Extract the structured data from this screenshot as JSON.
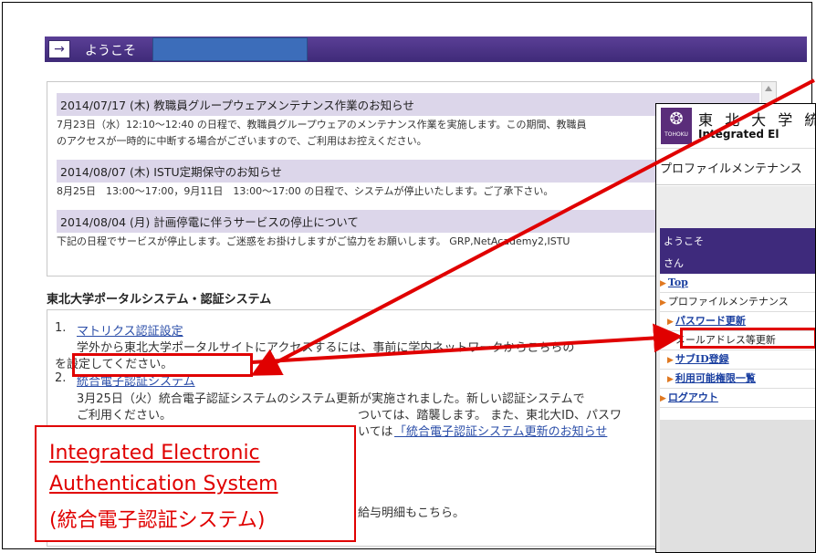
{
  "header": {
    "welcome_label": "ようこそ",
    "arrow_icon": "right-arrow-icon"
  },
  "news": [
    {
      "title": "2014/07/17 (木) 教職員グループウェアメンテナンス作業のお知らせ",
      "body_lines": [
        "7月23日（水）12:10～12:40 の日程で、教職員グループウェアのメンテナンス作業を実施します。この期間、教職員",
        "のアクセスが一時的に中断する場合がございますので、ご利用はお控えください。"
      ]
    },
    {
      "title": "2014/08/07 (木) ISTU定期保守のお知らせ",
      "body_lines": [
        "8月25日　13:00～17:00，9月11日　13:00～17:00 の日程で、システムが停止いたします。ご了承下さい。"
      ]
    },
    {
      "title": "2014/08/04 (月) 計画停電に伴うサービスの停止について",
      "body_lines": [
        "下記の日程でサービスが停止します。ご迷惑をお掛けしますがご協力をお願いします。 GRP,NetAcademy2,ISTU"
      ]
    }
  ],
  "portal": {
    "section_title": "東北大学ポータルシステム・認証システム",
    "items": [
      {
        "num": "1.",
        "link": "マトリクス認証設定",
        "desc_lines": [
          "学外から東北大学ポータルサイトにアクセスするには、事前に学内ネットワークからこちらの",
          "を設定してください。"
        ]
      },
      {
        "num": "2.",
        "link": "統合電子認証システム",
        "desc_lines": [
          "3月25日（火）統合電子認証システムのシステム更新が実施されました。新しい認証システムで",
          "ご利用ください。",
          "ついては、踏襲します。 また、東北大ID、パスワ",
          "いては",
          "「統合電子認証システム更新のお知らせ"
        ]
      }
    ],
    "bottom_line": "給与明細もこちら。"
  },
  "callout": {
    "line1": "Integrated Electronic",
    "line2": "Authentication System",
    "line3": "(統合電子認証システム)"
  },
  "side": {
    "logo_text": "TOHOKU",
    "university_jp": "東 北 大 学 統",
    "university_en": "Integrated El",
    "page_title": "プロファイルメンテナンス",
    "welcome": "ようこそ",
    "san": "さん",
    "menu": [
      {
        "label": "Top",
        "link": true,
        "indent": false
      },
      {
        "label": "プロファイルメンテナンス",
        "link": false,
        "indent": false
      },
      {
        "label": "パスワード更新",
        "link": true,
        "indent": true
      },
      {
        "label": "メールアドレス等更新",
        "link": false,
        "indent": true
      },
      {
        "label": "サブID登録",
        "link": true,
        "indent": true
      },
      {
        "label": "利用可能権限一覧",
        "link": true,
        "indent": true
      },
      {
        "label": "ログアウト",
        "link": true,
        "indent": false
      }
    ]
  },
  "colors": {
    "accent_purple": "#3f2a78",
    "highlight_red": "#e00000",
    "link_blue": "#2a4da8"
  }
}
